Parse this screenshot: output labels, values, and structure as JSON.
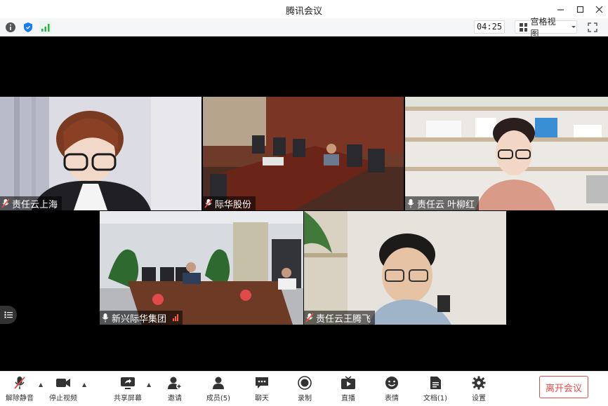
{
  "window": {
    "title": "腾讯会议"
  },
  "infobar": {
    "timer": "04:25",
    "view_label": "宫格视图"
  },
  "tiles": [
    {
      "name": "责任云上海"
    },
    {
      "name": "际华股份"
    },
    {
      "name": "责任云 叶柳红"
    },
    {
      "name": "新兴际华集团"
    },
    {
      "name": "责任云王腾飞"
    }
  ],
  "toolbar": {
    "mute": "解除静音",
    "video": "停止视频",
    "share": "共享屏幕",
    "invite": "邀请",
    "members": "成员(5)",
    "chat": "聊天",
    "record": "录制",
    "live": "直播",
    "reactions": "表情",
    "docs": "文档(1)",
    "settings": "设置",
    "leave": "离开会议"
  },
  "colors": {
    "accent": "#1a7cf2",
    "danger": "#e34b4b",
    "signal": "#2bb24c"
  }
}
